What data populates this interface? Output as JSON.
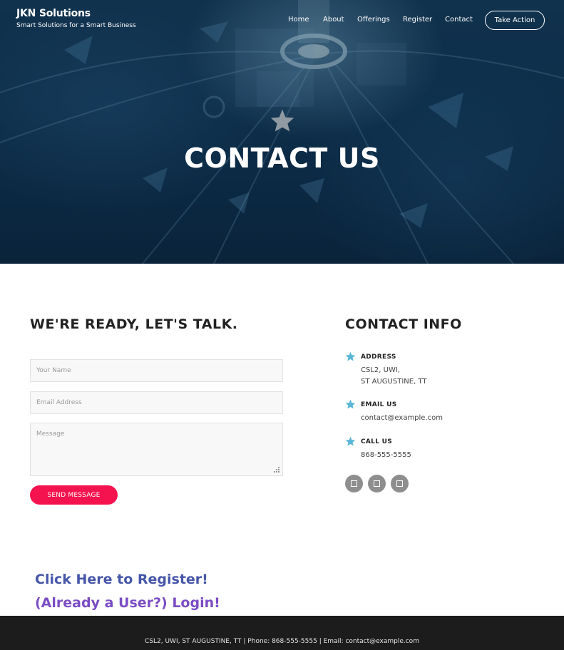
{
  "brand": {
    "name": "JKN Solutions",
    "tagline": "Smart Solutions for a Smart Business"
  },
  "nav": {
    "items": [
      "Home",
      "About",
      "Offerings",
      "Register",
      "Contact"
    ],
    "cta": "Take Action"
  },
  "hero": {
    "title": "CONTACT US",
    "icon": "star-icon"
  },
  "form": {
    "heading": "WE'RE READY, LET'S TALK.",
    "name_placeholder": "Your Name",
    "email_placeholder": "Email Address",
    "message_placeholder": "Message",
    "submit": "SEND MESSAGE"
  },
  "contact_info": {
    "heading": "CONTACT INFO",
    "address_label": "ADDRESS",
    "address_line1": "CSL2, UWI,",
    "address_line2": "ST AUGUSTINE, TT",
    "email_label": "EMAIL US",
    "email": "contact@example.com",
    "phone_label": "CALL US",
    "phone": "868-555-5555"
  },
  "links": {
    "register": "Click Here to Register!",
    "login": "(Already a User?) Login!"
  },
  "footer": {
    "text": "CSL2, UWI, ST AUGUSTINE, TT | Phone: 868-555-5555 | Email: contact@example.com"
  },
  "colors": {
    "accent_pink": "#f5134f",
    "info_star_blue": "#5ab6d8",
    "register_link": "#4656a8",
    "login_link": "#7a4cc4",
    "footer_bg": "#1c1c1c",
    "hero_bg": "#0f3656"
  }
}
